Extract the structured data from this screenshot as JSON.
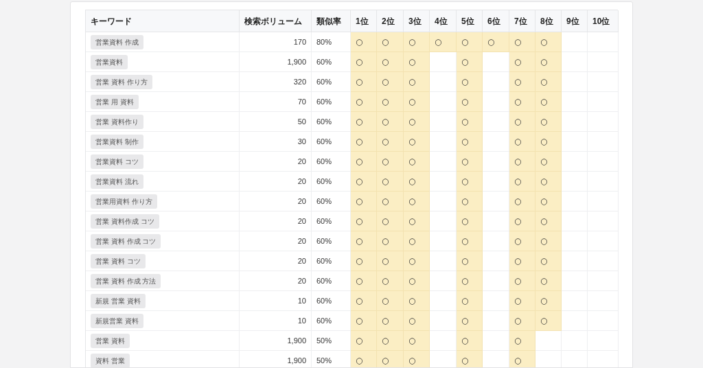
{
  "table": {
    "columns": [
      "キーワード",
      "検索ボリューム",
      "類似率",
      "1位",
      "2位",
      "3位",
      "4位",
      "5位",
      "6位",
      "7位",
      "8位",
      "9位",
      "10位"
    ],
    "rows": [
      {
        "keyword": "営業資料 作成",
        "volume": "170",
        "similarity": "80%",
        "ranks": [
          {
            "hit": true,
            "mark": "○"
          },
          {
            "hit": true,
            "mark": "○"
          },
          {
            "hit": true,
            "mark": "○"
          },
          {
            "hit": true,
            "mark": "○"
          },
          {
            "hit": true,
            "mark": "○"
          },
          {
            "hit": true,
            "mark": "○"
          },
          {
            "hit": true,
            "mark": "○"
          },
          {
            "hit": true,
            "mark": "○"
          },
          {
            "hit": false
          },
          {
            "hit": false
          }
        ]
      },
      {
        "keyword": "営業資料",
        "volume": "1,900",
        "similarity": "60%",
        "ranks": [
          {
            "hit": true,
            "mark": "○"
          },
          {
            "hit": true,
            "mark": "○"
          },
          {
            "hit": true,
            "mark": "○"
          },
          {
            "hit": false
          },
          {
            "hit": true,
            "mark": "○"
          },
          {
            "hit": false
          },
          {
            "hit": true,
            "mark": "○"
          },
          {
            "hit": true,
            "mark": "○"
          },
          {
            "hit": false
          },
          {
            "hit": false
          }
        ]
      },
      {
        "keyword": "営業 資料 作り方",
        "volume": "320",
        "similarity": "60%",
        "ranks": [
          {
            "hit": true,
            "mark": "○"
          },
          {
            "hit": true,
            "mark": "○"
          },
          {
            "hit": true,
            "mark": "○"
          },
          {
            "hit": false
          },
          {
            "hit": true,
            "mark": "○"
          },
          {
            "hit": false
          },
          {
            "hit": true,
            "mark": "○"
          },
          {
            "hit": true,
            "mark": "○"
          },
          {
            "hit": false
          },
          {
            "hit": false
          }
        ]
      },
      {
        "keyword": "営業 用 資料",
        "volume": "70",
        "similarity": "60%",
        "ranks": [
          {
            "hit": true,
            "mark": "○"
          },
          {
            "hit": true,
            "mark": "○"
          },
          {
            "hit": true,
            "mark": "○"
          },
          {
            "hit": false
          },
          {
            "hit": true,
            "mark": "○"
          },
          {
            "hit": false
          },
          {
            "hit": true,
            "mark": "○"
          },
          {
            "hit": true,
            "mark": "○"
          },
          {
            "hit": false
          },
          {
            "hit": false
          }
        ]
      },
      {
        "keyword": "営業 資料作り",
        "volume": "50",
        "similarity": "60%",
        "ranks": [
          {
            "hit": true,
            "mark": "○"
          },
          {
            "hit": true,
            "mark": "○"
          },
          {
            "hit": true,
            "mark": "○"
          },
          {
            "hit": false
          },
          {
            "hit": true,
            "mark": "○"
          },
          {
            "hit": false
          },
          {
            "hit": true,
            "mark": "○"
          },
          {
            "hit": true,
            "mark": "○"
          },
          {
            "hit": false
          },
          {
            "hit": false
          }
        ]
      },
      {
        "keyword": "営業資料 制作",
        "volume": "30",
        "similarity": "60%",
        "ranks": [
          {
            "hit": true,
            "mark": "○"
          },
          {
            "hit": true,
            "mark": "○"
          },
          {
            "hit": true,
            "mark": "○"
          },
          {
            "hit": false
          },
          {
            "hit": true,
            "mark": "○"
          },
          {
            "hit": false
          },
          {
            "hit": true,
            "mark": "○"
          },
          {
            "hit": true,
            "mark": "○"
          },
          {
            "hit": false
          },
          {
            "hit": false
          }
        ]
      },
      {
        "keyword": "営業資料 コツ",
        "volume": "20",
        "similarity": "60%",
        "ranks": [
          {
            "hit": true,
            "mark": "○"
          },
          {
            "hit": true,
            "mark": "○"
          },
          {
            "hit": true,
            "mark": "○"
          },
          {
            "hit": false
          },
          {
            "hit": true,
            "mark": "○"
          },
          {
            "hit": false
          },
          {
            "hit": true,
            "mark": "○"
          },
          {
            "hit": true,
            "mark": "○"
          },
          {
            "hit": false
          },
          {
            "hit": false
          }
        ]
      },
      {
        "keyword": "営業資料 流れ",
        "volume": "20",
        "similarity": "60%",
        "ranks": [
          {
            "hit": true,
            "mark": "○"
          },
          {
            "hit": true,
            "mark": "○"
          },
          {
            "hit": true,
            "mark": "○"
          },
          {
            "hit": false
          },
          {
            "hit": true,
            "mark": "○"
          },
          {
            "hit": false
          },
          {
            "hit": true,
            "mark": "○"
          },
          {
            "hit": true,
            "mark": "○"
          },
          {
            "hit": false
          },
          {
            "hit": false
          }
        ]
      },
      {
        "keyword": "営業用資料 作り方",
        "volume": "20",
        "similarity": "60%",
        "ranks": [
          {
            "hit": true,
            "mark": "○"
          },
          {
            "hit": true,
            "mark": "○"
          },
          {
            "hit": true,
            "mark": "○"
          },
          {
            "hit": false
          },
          {
            "hit": true,
            "mark": "○"
          },
          {
            "hit": false
          },
          {
            "hit": true,
            "mark": "○"
          },
          {
            "hit": true,
            "mark": "○"
          },
          {
            "hit": false
          },
          {
            "hit": false
          }
        ]
      },
      {
        "keyword": "営業 資料作成 コツ",
        "volume": "20",
        "similarity": "60%",
        "ranks": [
          {
            "hit": true,
            "mark": "○"
          },
          {
            "hit": true,
            "mark": "○"
          },
          {
            "hit": true,
            "mark": "○"
          },
          {
            "hit": false
          },
          {
            "hit": true,
            "mark": "○"
          },
          {
            "hit": false
          },
          {
            "hit": true,
            "mark": "○"
          },
          {
            "hit": true,
            "mark": "○"
          },
          {
            "hit": false
          },
          {
            "hit": false
          }
        ]
      },
      {
        "keyword": "営業 資料 作成 コツ",
        "volume": "20",
        "similarity": "60%",
        "ranks": [
          {
            "hit": true,
            "mark": "○"
          },
          {
            "hit": true,
            "mark": "○"
          },
          {
            "hit": true,
            "mark": "○"
          },
          {
            "hit": false
          },
          {
            "hit": true,
            "mark": "○"
          },
          {
            "hit": false
          },
          {
            "hit": true,
            "mark": "○"
          },
          {
            "hit": true,
            "mark": "○"
          },
          {
            "hit": false
          },
          {
            "hit": false
          }
        ]
      },
      {
        "keyword": "営業 資料 コツ",
        "volume": "20",
        "similarity": "60%",
        "ranks": [
          {
            "hit": true,
            "mark": "○"
          },
          {
            "hit": true,
            "mark": "○"
          },
          {
            "hit": true,
            "mark": "○"
          },
          {
            "hit": false
          },
          {
            "hit": true,
            "mark": "○"
          },
          {
            "hit": false
          },
          {
            "hit": true,
            "mark": "○"
          },
          {
            "hit": true,
            "mark": "○"
          },
          {
            "hit": false
          },
          {
            "hit": false
          }
        ]
      },
      {
        "keyword": "営業 資料 作成 方法",
        "volume": "20",
        "similarity": "60%",
        "ranks": [
          {
            "hit": true,
            "mark": "○"
          },
          {
            "hit": true,
            "mark": "○"
          },
          {
            "hit": true,
            "mark": "○"
          },
          {
            "hit": false
          },
          {
            "hit": true,
            "mark": "○"
          },
          {
            "hit": false
          },
          {
            "hit": true,
            "mark": "○"
          },
          {
            "hit": true,
            "mark": "○"
          },
          {
            "hit": false
          },
          {
            "hit": false
          }
        ]
      },
      {
        "keyword": "新規 営業 資料",
        "volume": "10",
        "similarity": "60%",
        "ranks": [
          {
            "hit": true,
            "mark": "○"
          },
          {
            "hit": true,
            "mark": "○"
          },
          {
            "hit": true,
            "mark": "○"
          },
          {
            "hit": false
          },
          {
            "hit": true,
            "mark": "○"
          },
          {
            "hit": false
          },
          {
            "hit": true,
            "mark": "○"
          },
          {
            "hit": true,
            "mark": "○"
          },
          {
            "hit": false
          },
          {
            "hit": false
          }
        ]
      },
      {
        "keyword": "新規営業 資料",
        "volume": "10",
        "similarity": "60%",
        "ranks": [
          {
            "hit": true,
            "mark": "○"
          },
          {
            "hit": true,
            "mark": "○"
          },
          {
            "hit": true,
            "mark": "○"
          },
          {
            "hit": false
          },
          {
            "hit": true,
            "mark": "○"
          },
          {
            "hit": false
          },
          {
            "hit": true,
            "mark": "○"
          },
          {
            "hit": true,
            "mark": "○"
          },
          {
            "hit": false
          },
          {
            "hit": false
          }
        ]
      },
      {
        "keyword": "営業 資料",
        "volume": "1,900",
        "similarity": "50%",
        "ranks": [
          {
            "hit": true,
            "mark": "○"
          },
          {
            "hit": true,
            "mark": "○"
          },
          {
            "hit": true,
            "mark": "○"
          },
          {
            "hit": false
          },
          {
            "hit": true,
            "mark": "○"
          },
          {
            "hit": false
          },
          {
            "hit": true,
            "mark": "○"
          },
          {
            "hit": false
          },
          {
            "hit": false
          },
          {
            "hit": false
          }
        ]
      },
      {
        "keyword": "資料 営業",
        "volume": "1,900",
        "similarity": "50%",
        "ranks": [
          {
            "hit": true,
            "mark": "○"
          },
          {
            "hit": true,
            "mark": "○"
          },
          {
            "hit": true,
            "mark": "○"
          },
          {
            "hit": false
          },
          {
            "hit": true,
            "mark": "○"
          },
          {
            "hit": false
          },
          {
            "hit": true,
            "mark": "○"
          },
          {
            "hit": false
          },
          {
            "hit": false
          },
          {
            "hit": false
          }
        ]
      }
    ]
  }
}
